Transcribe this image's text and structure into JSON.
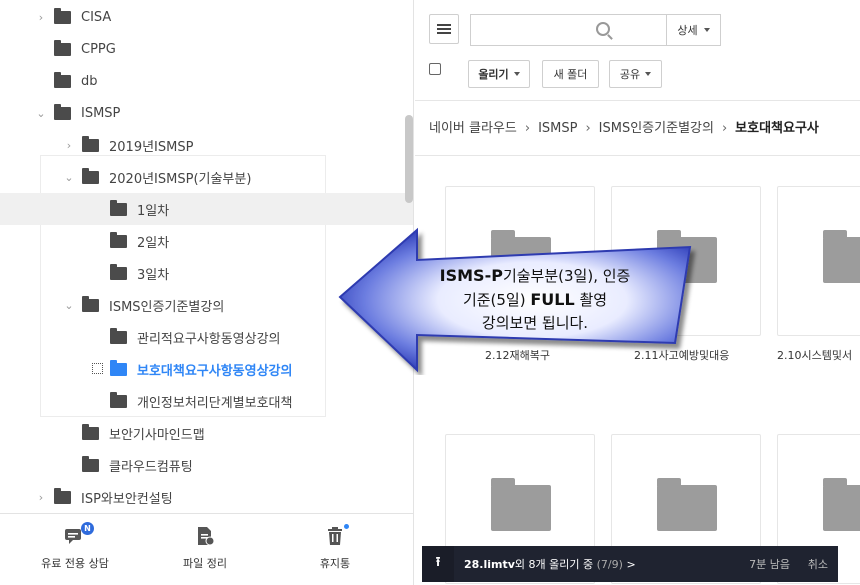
{
  "tree": {
    "items": [
      {
        "label": "CISA",
        "chevron": "›"
      },
      {
        "label": "CPPG",
        "chevron": ""
      },
      {
        "label": "db",
        "chevron": ""
      },
      {
        "label": "ISMSP",
        "chevron": "⌄"
      },
      {
        "label": "2019년ISMSP",
        "chevron": "›"
      },
      {
        "label": "2020년ISMSP(기술부분)",
        "chevron": "⌄"
      },
      {
        "label": "1일차",
        "chevron": ""
      },
      {
        "label": "2일차",
        "chevron": ""
      },
      {
        "label": "3일차",
        "chevron": ""
      },
      {
        "label": "ISMS인증기준별강의",
        "chevron": "⌄"
      },
      {
        "label": "관리적요구사항동영상강의",
        "chevron": ""
      },
      {
        "label": "보호대책요구사항동영상강의",
        "chevron": ""
      },
      {
        "label": "개인정보처리단계별보호대책",
        "chevron": ""
      },
      {
        "label": "보안기사마인드맵",
        "chevron": ""
      },
      {
        "label": "클라우드컴퓨팅",
        "chevron": ""
      },
      {
        "label": "ISP와보안컨설팅",
        "chevron": "›"
      }
    ]
  },
  "bottom_nav": {
    "chat": {
      "label": "유료 전용 상담",
      "icon": "chat-icon",
      "badge": "N"
    },
    "organize": {
      "label": "파일 정리",
      "icon": "file-clean-icon"
    },
    "trash": {
      "label": "휴지통",
      "icon": "trash-icon"
    }
  },
  "toolbar": {
    "search_placeholder": "",
    "detail_label": "상세",
    "upload_label": "올리기",
    "new_folder_label": "새 폴더",
    "share_label": "공유"
  },
  "breadcrumb": {
    "items": [
      "네이버 클라우드",
      "ISMSP",
      "ISMS인증기준별강의"
    ],
    "current": "보호대책요구사"
  },
  "cards": {
    "labels": [
      "2.12재해복구",
      "2.11사고예방및대응",
      "2.10시스템및서"
    ]
  },
  "overlay": {
    "line1_bold": "ISMS-P",
    "line1_rest": "기술부분(3일), 인증",
    "line2_a": "기준(5일) ",
    "line2_bold": "FULL",
    "line2_b": " 촬영",
    "line3": "강의보면 됩니다."
  },
  "upload_bar": {
    "icon": "upload-icon",
    "name": "28.limtv",
    "text": "외 8개 올리기 중",
    "progress": "(7/9)",
    "chevron": ">",
    "remaining": "7분 남음",
    "cancel": "취소"
  },
  "colors": {
    "accent": "#2f86f6",
    "folder": "#4b4b4b",
    "upload_bar_bg": "#1f2330",
    "arrow_fill": "#3345c9"
  }
}
